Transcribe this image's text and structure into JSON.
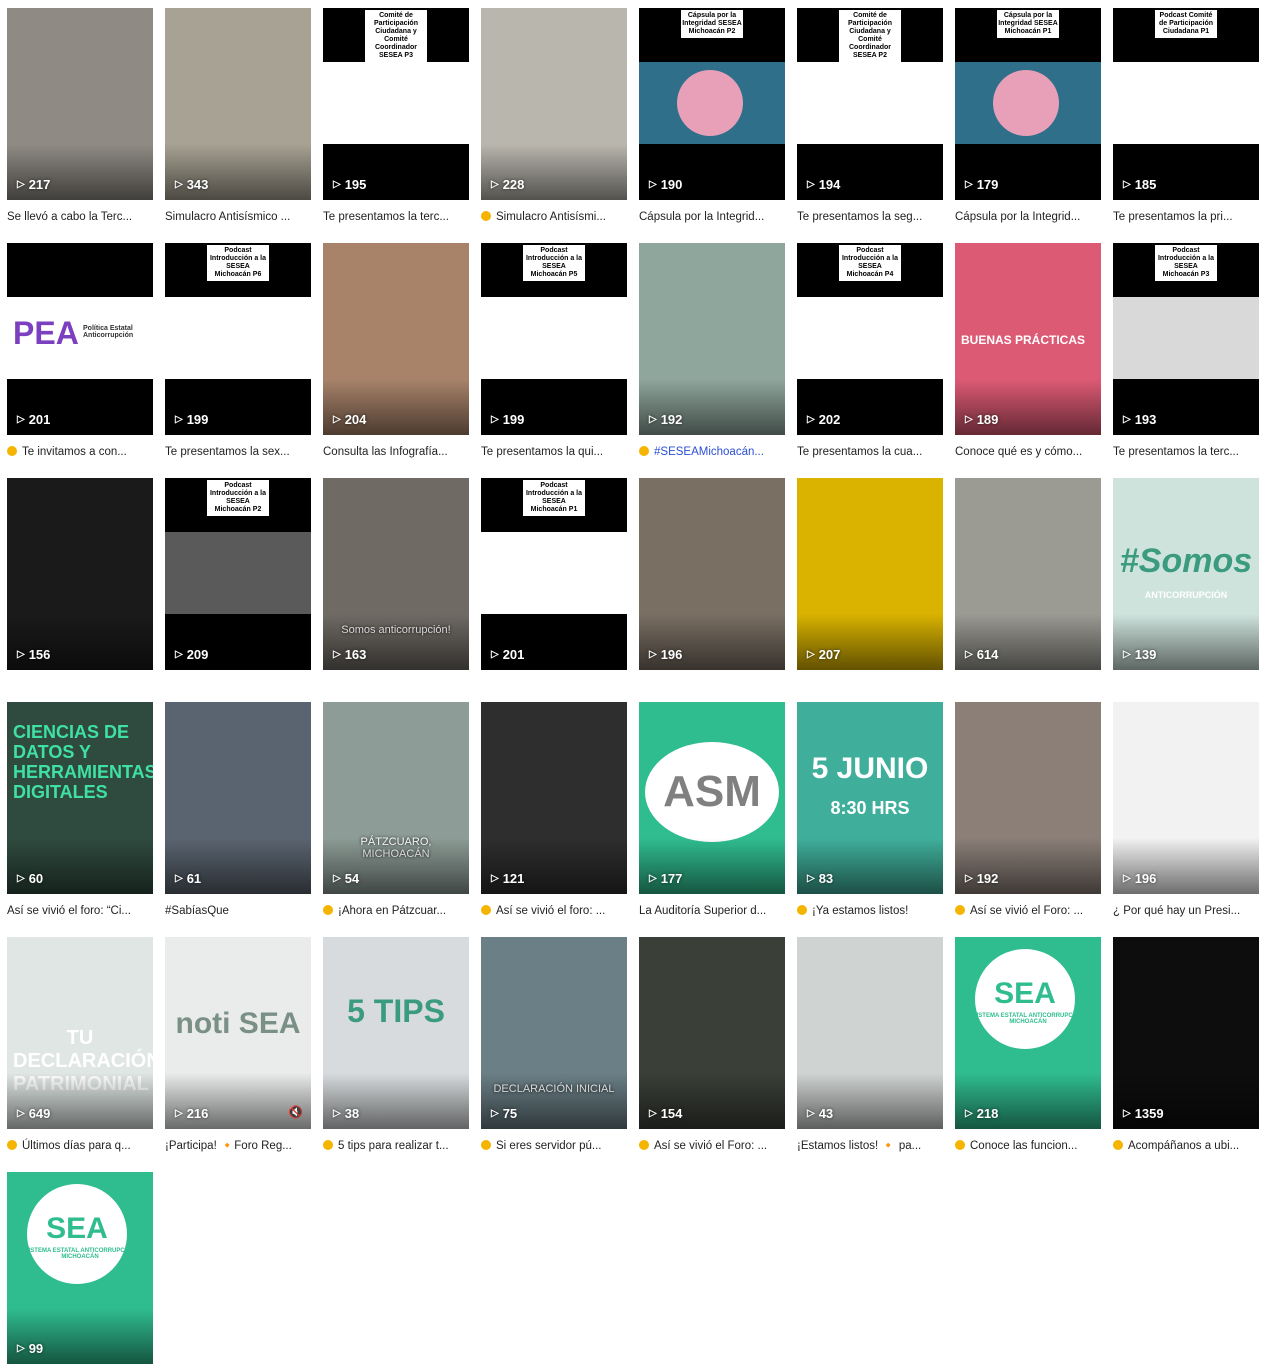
{
  "rows": [
    {
      "videos": [
        {
          "views": "217",
          "caption": "Se llevó a cabo la Terc...",
          "bg": "#8f8b84",
          "style": "photo"
        },
        {
          "views": "343",
          "caption": "Simulacro Antisísmico ...",
          "bg": "#a7a293",
          "style": "photo"
        },
        {
          "views": "195",
          "caption": "Te presentamos la terc...",
          "bg": "#ffffff",
          "style": "podcast",
          "card": "Comité de Participación Ciudadana y Comité Coordinador SESEA P3"
        },
        {
          "views": "228",
          "caption": "Simulacro Antisísmi...",
          "bg": "#b9b6ad",
          "style": "photo",
          "emoji": true
        },
        {
          "views": "190",
          "caption": "Cápsula por la Integrid...",
          "bg": "#ffffff",
          "style": "capsula",
          "card": "Cápsula por la Integridad SESEA Michoacán P2"
        },
        {
          "views": "194",
          "caption": "Te presentamos la seg...",
          "bg": "#ffffff",
          "style": "podcast",
          "card": "Comité de Participación Ciudadana y Comité Coordinador SESEA P2"
        },
        {
          "views": "179",
          "caption": "Cápsula por la Integrid...",
          "bg": "#ffffff",
          "style": "capsula",
          "card": "Cápsula por la Integridad SESEA Michoacán P1"
        },
        {
          "views": "185",
          "caption": "Te presentamos la pri...",
          "bg": "#ffffff",
          "style": "podcast",
          "card": "Podcast Comité de Participación Ciudadana P1"
        }
      ]
    },
    {
      "videos": [
        {
          "views": "201",
          "caption": "Te invitamos a con...",
          "bg": "#ffffff",
          "style": "pea",
          "logo": "PEA",
          "logo_sub": "Política Estatal Anticorrupción",
          "emoji": true
        },
        {
          "views": "199",
          "caption": "Te presentamos la sex...",
          "bg": "#ffffff",
          "style": "podcast",
          "card": "Podcast Introducción a la SESEA Michoacán P6"
        },
        {
          "views": "204",
          "caption": "Consulta las Infografía...",
          "bg": "#a8836a",
          "style": "photo"
        },
        {
          "views": "199",
          "caption": "Te presentamos la qui...",
          "bg": "#ffffff",
          "style": "podcast",
          "card": "Podcast Introducción a la SESEA Michoacán P5"
        },
        {
          "views": "192",
          "caption": "#SESEAMichoacán...",
          "bg": "#8fa69c",
          "style": "photo",
          "emoji": true,
          "blue": true
        },
        {
          "views": "202",
          "caption": "Te presentamos la cua...",
          "bg": "#ffffff",
          "style": "podcast",
          "card": "Podcast Introducción a la SESEA Michoacán P4"
        },
        {
          "views": "189",
          "caption": "Conoce qué es y cómo...",
          "bg": "#dd5a74",
          "style": "buenas",
          "text": "BUENAS PRÁCTICAS"
        },
        {
          "views": "193",
          "caption": "Te presentamos la terc...",
          "bg": "#d9d9d9",
          "style": "podcast",
          "card": "Podcast Introducción a la SESEA Michoacán P3"
        }
      ]
    },
    {
      "videos": [
        {
          "views": "156",
          "caption": "",
          "bg": "#1a1a1a",
          "style": "photo"
        },
        {
          "views": "209",
          "caption": "",
          "bg": "#5a5a5a",
          "style": "podcast",
          "card": "Podcast Introducción a la SESEA Michoacán P2"
        },
        {
          "views": "163",
          "caption": "",
          "bg": "#6f6a64",
          "style": "photo",
          "overlay": "Somos anticorrupción!"
        },
        {
          "views": "201",
          "caption": "",
          "bg": "#ffffff",
          "style": "podcast",
          "card": "Podcast Introducción a la SESEA Michoacán P1"
        },
        {
          "views": "196",
          "caption": "",
          "bg": "#7a6f63",
          "style": "photo"
        },
        {
          "views": "207",
          "caption": "",
          "bg": "#d9b300",
          "style": "photo"
        },
        {
          "views": "614",
          "caption": "",
          "bg": "#9b9a93",
          "style": "photo"
        },
        {
          "views": "139",
          "caption": "",
          "bg": "#cfe3dd",
          "style": "somos",
          "text": "#Somos",
          "sub": "ANTICORRUPCIÓN"
        }
      ]
    },
    {
      "videos": [
        {
          "views": "60",
          "caption": "Así se vivió el foro: “Ci...",
          "bg": "#2f4b3f",
          "style": "ciencias",
          "text": "CIENCIAS DE DATOS Y HERRAMIENTAS DIGITALES"
        },
        {
          "views": "61",
          "caption": "#SabíasQue",
          "bg": "#5a6470",
          "style": "photo"
        },
        {
          "views": "54",
          "caption": "¡Ahora en Pátzcuar...",
          "bg": "#8d9c96",
          "style": "photo",
          "overlay": "PÁTZCUARO, MICHOACÁN",
          "emoji": true
        },
        {
          "views": "121",
          "caption": "Así se vivió el foro: ...",
          "bg": "#2e2e2e",
          "style": "photo",
          "emoji": true
        },
        {
          "views": "177",
          "caption": "La Auditoría Superior d...",
          "bg": "#2fbd8f",
          "style": "asm",
          "text": "ASM"
        },
        {
          "views": "83",
          "caption": "¡Ya estamos listos!",
          "bg": "#3faf9b",
          "style": "junio",
          "text": "5 JUNIO",
          "sub": "8:30 HRS",
          "emoji": true
        },
        {
          "views": "192",
          "caption": "Así se vivió el Foro: ...",
          "bg": "#8b7f78",
          "style": "photo",
          "emoji": true
        },
        {
          "views": "196",
          "caption": "¿ Por qué hay un Presi...",
          "bg": "#f2f2f2",
          "style": "photo"
        }
      ]
    },
    {
      "videos": [
        {
          "views": "649",
          "caption": "Últimos días para q...",
          "bg": "#dfe6e3",
          "style": "tu",
          "text": "TU DECLARACIÓN PATRIMONIAL",
          "emoji": true
        },
        {
          "views": "216",
          "caption": "¡Participa! 🔸Foro Reg...",
          "bg": "#e9ecea",
          "style": "noti",
          "text": "noti SEA"
        },
        {
          "views": "38",
          "caption": "5 tips para realizar t...",
          "bg": "#d7dbdd",
          "style": "tips",
          "text": "5 TIPS",
          "emoji": true
        },
        {
          "views": "75",
          "caption": "Si eres servidor pú...",
          "bg": "#6a7f86",
          "style": "photo",
          "overlay": "DECLARACIÓN INICIAL",
          "emoji": true
        },
        {
          "views": "154",
          "caption": "Así se vivió el Foro: ...",
          "bg": "#3a3f38",
          "style": "photo",
          "emoji": true
        },
        {
          "views": "43",
          "caption": "¡Estamos listos! 🔸 pa...",
          "bg": "#cfd3d1",
          "style": "photo"
        },
        {
          "views": "218",
          "caption": "Conoce las funcion...",
          "bg": "#2fbd8f",
          "style": "sea",
          "text": "SEA",
          "sub": "SISTEMA ESTATAL ANTICORRUPCIÓN MICHOACÁN",
          "emoji": true
        },
        {
          "views": "1359",
          "caption": "Acompáñanos a ubi...",
          "bg": "#0d0d0d",
          "style": "photo",
          "emoji": true
        }
      ]
    },
    {
      "videos": [
        {
          "views": "99",
          "caption": "",
          "bg": "#2fbd8f",
          "style": "sea",
          "text": "SEA",
          "sub": "SISTEMA ESTATAL ANTICORRUPCIÓN MICHOACÁN"
        }
      ]
    }
  ],
  "icons": {
    "play": "play-icon",
    "mute": "mute-icon"
  }
}
